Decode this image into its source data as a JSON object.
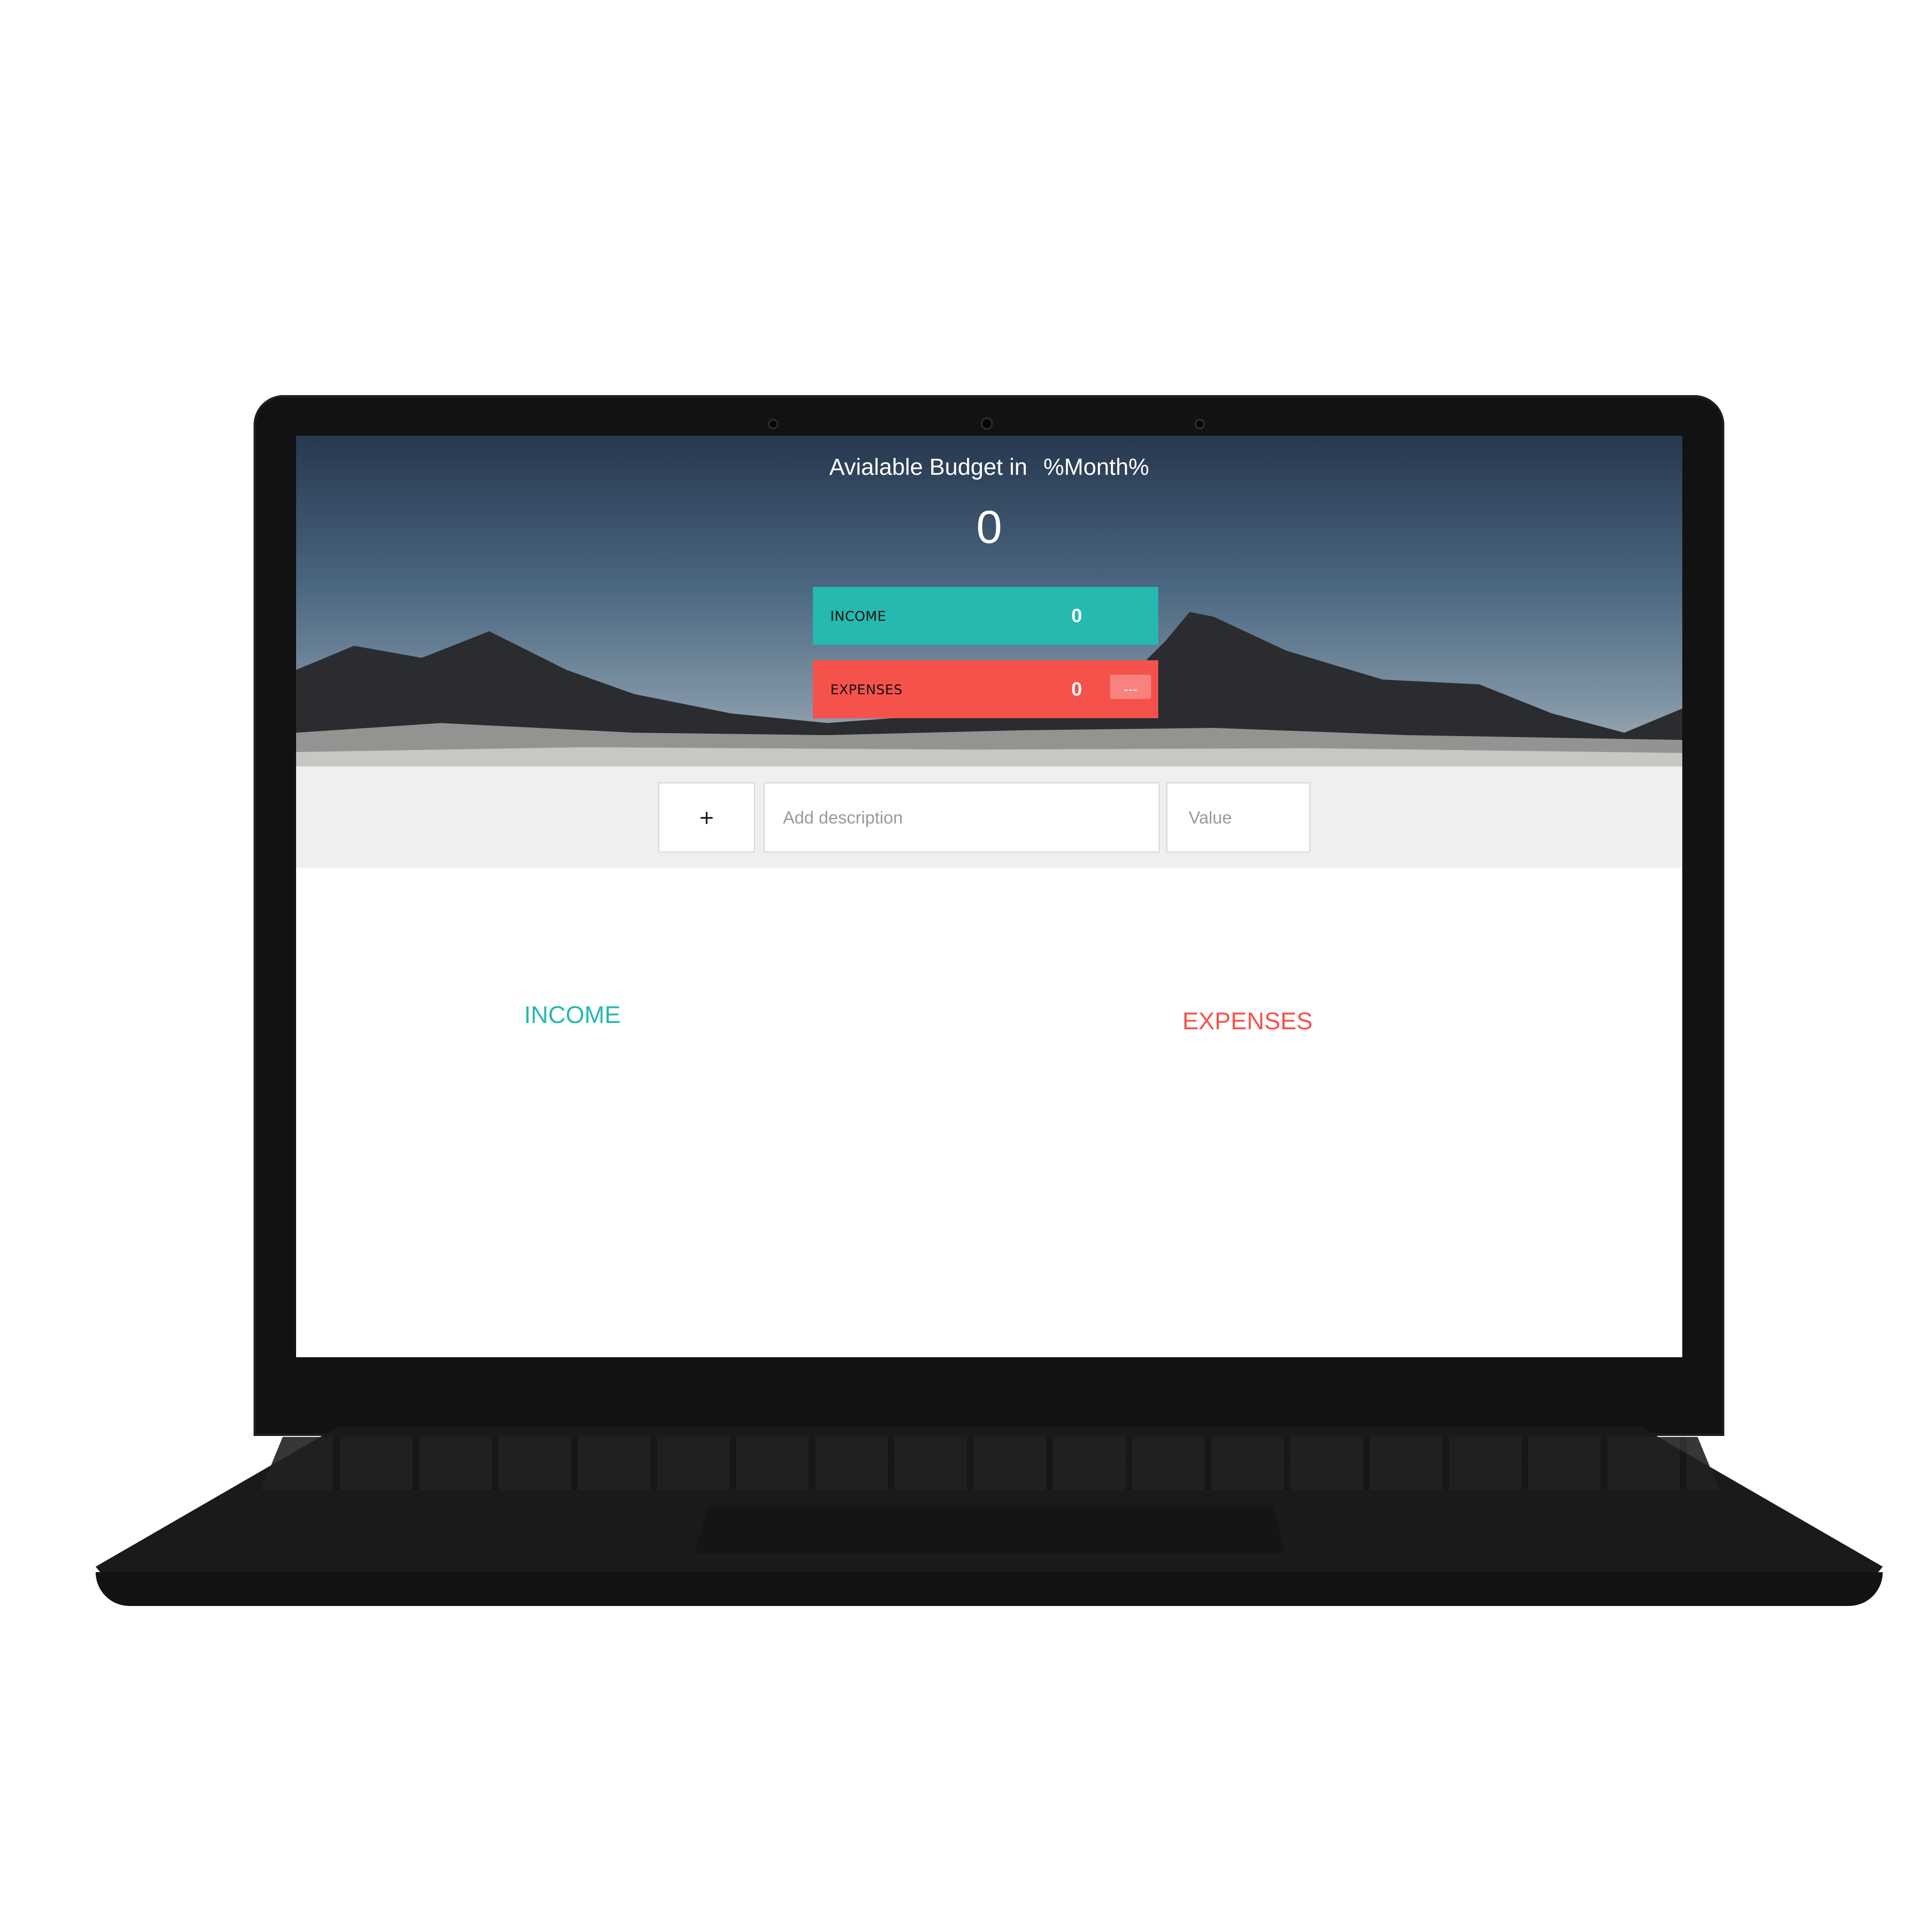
{
  "header": {
    "title_prefix": "Avialable Budget in",
    "month_placeholder": "%Month%",
    "budget_value": "0"
  },
  "summary": {
    "income": {
      "label": "INCOME",
      "value": "0"
    },
    "expenses": {
      "label": "EXPENSES",
      "value": "0",
      "percentage": "---"
    }
  },
  "add_form": {
    "type_symbol": "+",
    "description_placeholder": "Add description",
    "value_placeholder": "Value"
  },
  "lists": {
    "income_title": "INCOME",
    "expenses_title": "EXPENSES"
  },
  "colors": {
    "income_accent": "#26b9b0",
    "expenses_accent": "#f5524c",
    "add_bar_background": "#efefef"
  }
}
